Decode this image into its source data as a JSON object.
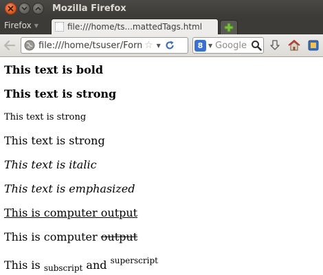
{
  "window": {
    "title": "Mozilla Firefox"
  },
  "tabbar": {
    "menu_label": "Firefox",
    "tab_title": "file:///home/ts...mattedTags.html"
  },
  "navbar": {
    "url": "file:///home/tsuser/Form",
    "search_placeholder": "Google",
    "search_engine_letter": "8"
  },
  "content": {
    "bold_text": "This text is bold",
    "strong_text": "This text is strong",
    "small_text": "This text is strong",
    "normal_text": "This text is strong",
    "italic_text": "This text is italic",
    "emphasized_text": "This text is emphasized",
    "computer_output_underlined": "This is computer output",
    "computer_output_prefix": "This is computer ",
    "computer_output_struck": "output",
    "subsup_prefix": "This is ",
    "subscript": "subscript",
    "subsup_and": " and ",
    "superscript": "superscript"
  },
  "colors": {
    "titlebar": "#3c3b37",
    "close_button": "#e0531a",
    "tab_background": "#edeceb",
    "new_tab_plus": "#7ac142"
  },
  "icons": {
    "close": "close-icon",
    "minimize": "minimize-icon",
    "maximize": "maximize-icon",
    "back": "back-arrow-icon",
    "globe": "globe-icon",
    "bookmark_star": "star-icon",
    "reload": "reload-icon",
    "search": "magnifier-icon",
    "downloads": "download-arrow-icon",
    "home": "home-icon",
    "addon": "addon-icon"
  }
}
